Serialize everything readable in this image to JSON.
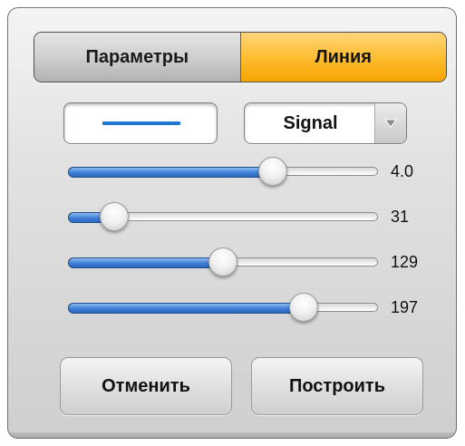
{
  "tabs": [
    {
      "label": "Параметры",
      "selected": false
    },
    {
      "label": "Линия",
      "selected": true
    }
  ],
  "line": {
    "color": "#1f78d1",
    "series": {
      "selected": "Signal",
      "arrow_icon": "chevron-down-icon"
    }
  },
  "sliders": [
    {
      "value": 0.66,
      "display": "4.0"
    },
    {
      "value": 0.15,
      "display": "31"
    },
    {
      "value": 0.5,
      "display": "129"
    },
    {
      "value": 0.76,
      "display": "197"
    }
  ],
  "buttons": {
    "cancel": "Отменить",
    "build": "Построить"
  },
  "colors": {
    "accent": "#ffbe33",
    "slider_fill": "#3f80d6"
  }
}
